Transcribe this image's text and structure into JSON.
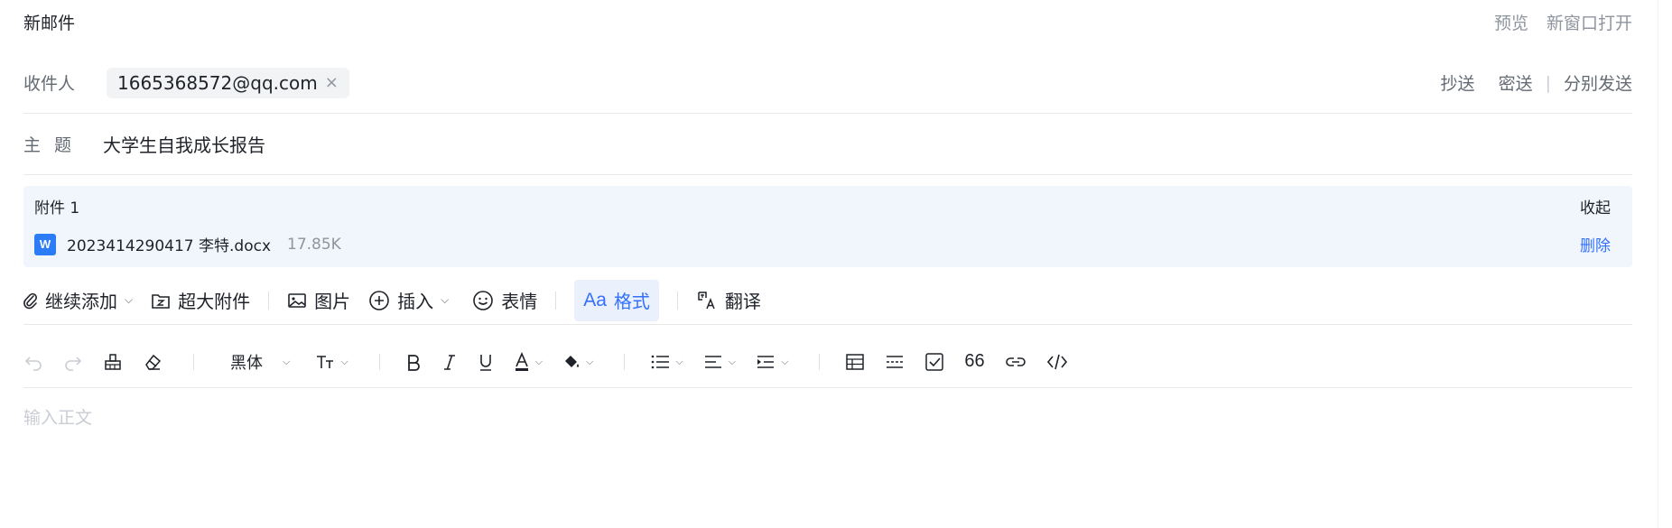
{
  "header": {
    "title": "新邮件",
    "preview": "预览",
    "open_new_window": "新窗口打开"
  },
  "recipients": {
    "label": "收件人",
    "to": [
      "1665368572@qq.com"
    ],
    "remove_icon": "×",
    "cc": "抄送",
    "bcc": "密送",
    "separator": "|",
    "separate_send": "分别发送"
  },
  "subject": {
    "label": "主题",
    "value": "大学生自我成长报告"
  },
  "attachments": {
    "header": "附件 1",
    "collapse": "收起",
    "items": [
      {
        "icon_letter": "W",
        "name": "2023414290417 李特.docx",
        "size": "17.85K",
        "delete": "删除"
      }
    ]
  },
  "toolbar": {
    "add_more": "继续添加",
    "large_attachment": "超大附件",
    "image": "图片",
    "insert": "插入",
    "emoji": "表情",
    "format_prefix": "Aa",
    "format": "格式",
    "translate": "翻译"
  },
  "format_toolbar": {
    "font": "黑体",
    "quote": "66"
  },
  "body": {
    "placeholder": "输入正文"
  },
  "colors": {
    "accent": "#3370ff",
    "attachment_bg": "#f1f6fd",
    "word_icon": "#2b7cf6"
  }
}
